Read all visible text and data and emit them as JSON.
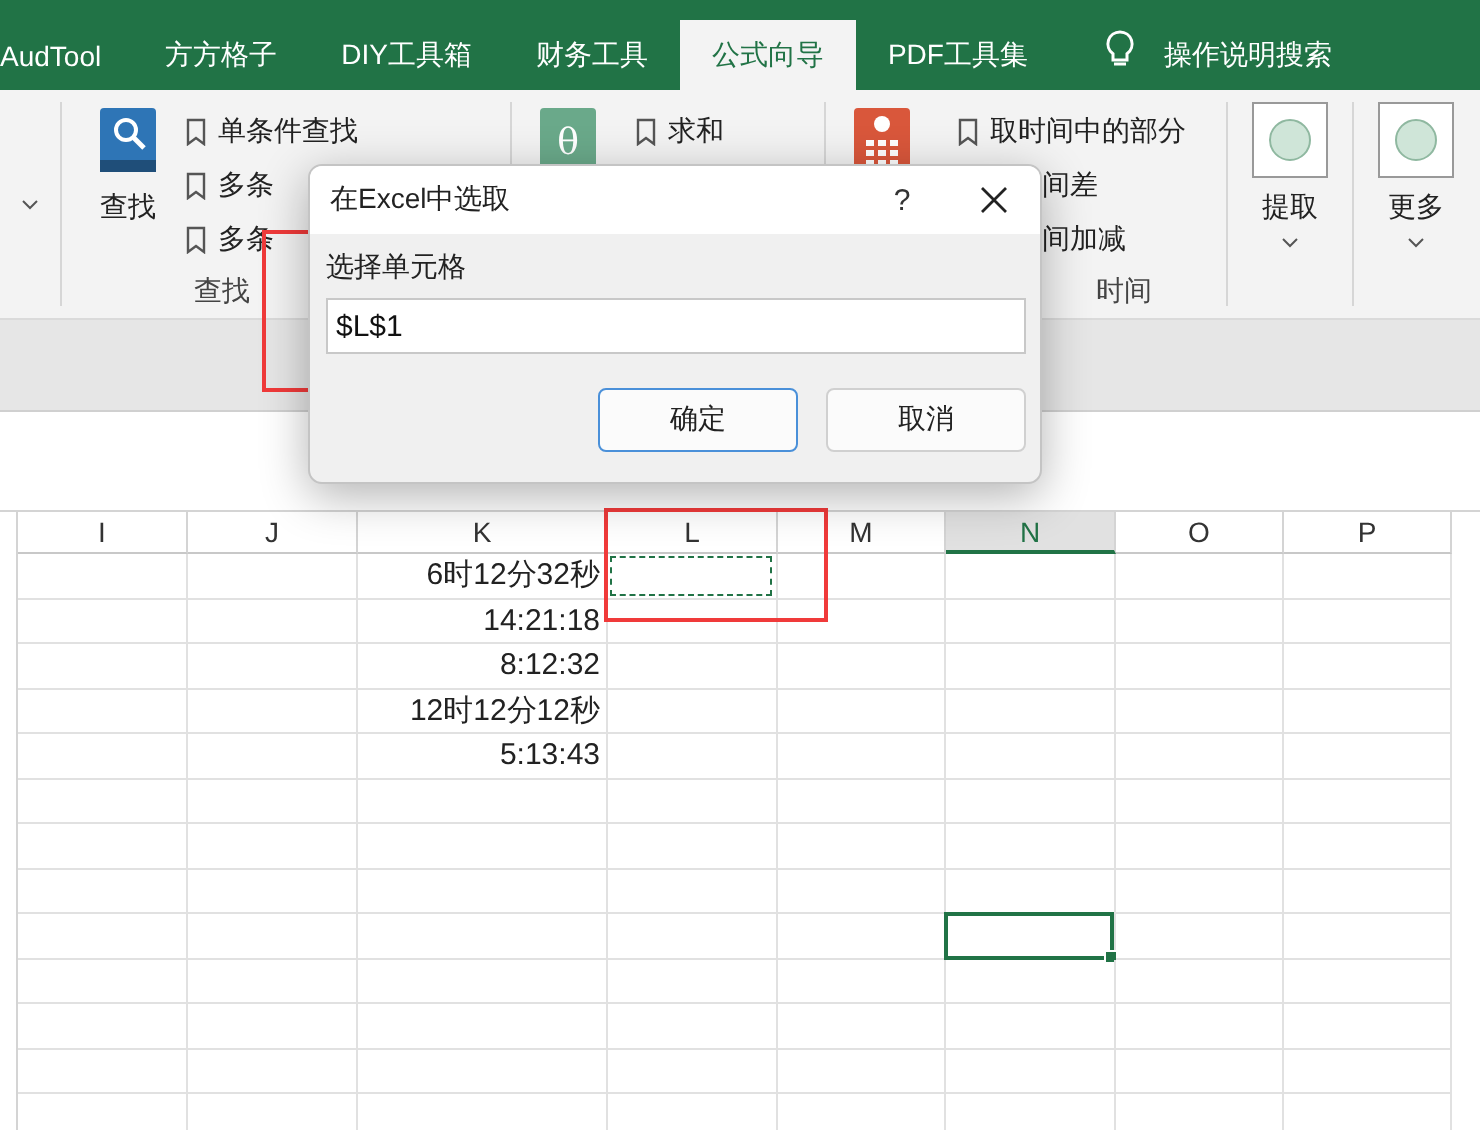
{
  "tabs": [
    {
      "label": "AudTool",
      "selected": false
    },
    {
      "label": "方方格子",
      "selected": false
    },
    {
      "label": "DIY工具箱",
      "selected": false
    },
    {
      "label": "财务工具",
      "selected": false
    },
    {
      "label": "公式向导",
      "selected": true
    },
    {
      "label": "PDF工具集",
      "selected": false
    }
  ],
  "search": {
    "placeholder": "操作说明搜索"
  },
  "ribbon": {
    "lookup": {
      "label": "查找",
      "items": [
        "单条件查找",
        "多条",
        "多条"
      ],
      "group_label": "查找"
    },
    "sum": {
      "icon_glyph": "θ",
      "items": [
        "求和"
      ]
    },
    "time": {
      "items": [
        "取时间中的部分",
        "间差",
        "间加减"
      ],
      "group_label": "时间"
    },
    "extract": {
      "label": "提取"
    },
    "more": {
      "label": "更多"
    }
  },
  "dialog": {
    "title": "在Excel中选取",
    "help": "?",
    "field_label": "选择单元格",
    "value": "$L$1",
    "buttons": [
      {
        "label": "确定",
        "default": true
      },
      {
        "label": "取消",
        "default": false
      }
    ]
  },
  "columns": [
    {
      "name": "I",
      "selected": false,
      "marquee": false
    },
    {
      "name": "J",
      "selected": false,
      "marquee": false
    },
    {
      "name": "K",
      "selected": false,
      "marquee": false
    },
    {
      "name": "L",
      "selected": false,
      "marquee": true
    },
    {
      "name": "M",
      "selected": false,
      "marquee": false
    },
    {
      "name": "N",
      "selected": true,
      "marquee": false
    },
    {
      "name": "O",
      "selected": false,
      "marquee": false
    },
    {
      "name": "P",
      "selected": false,
      "marquee": false
    }
  ],
  "column_k_values": [
    "6时12分32秒",
    "14:21:18",
    "8:12:32",
    "12时12分12秒",
    "5:13:43"
  ]
}
